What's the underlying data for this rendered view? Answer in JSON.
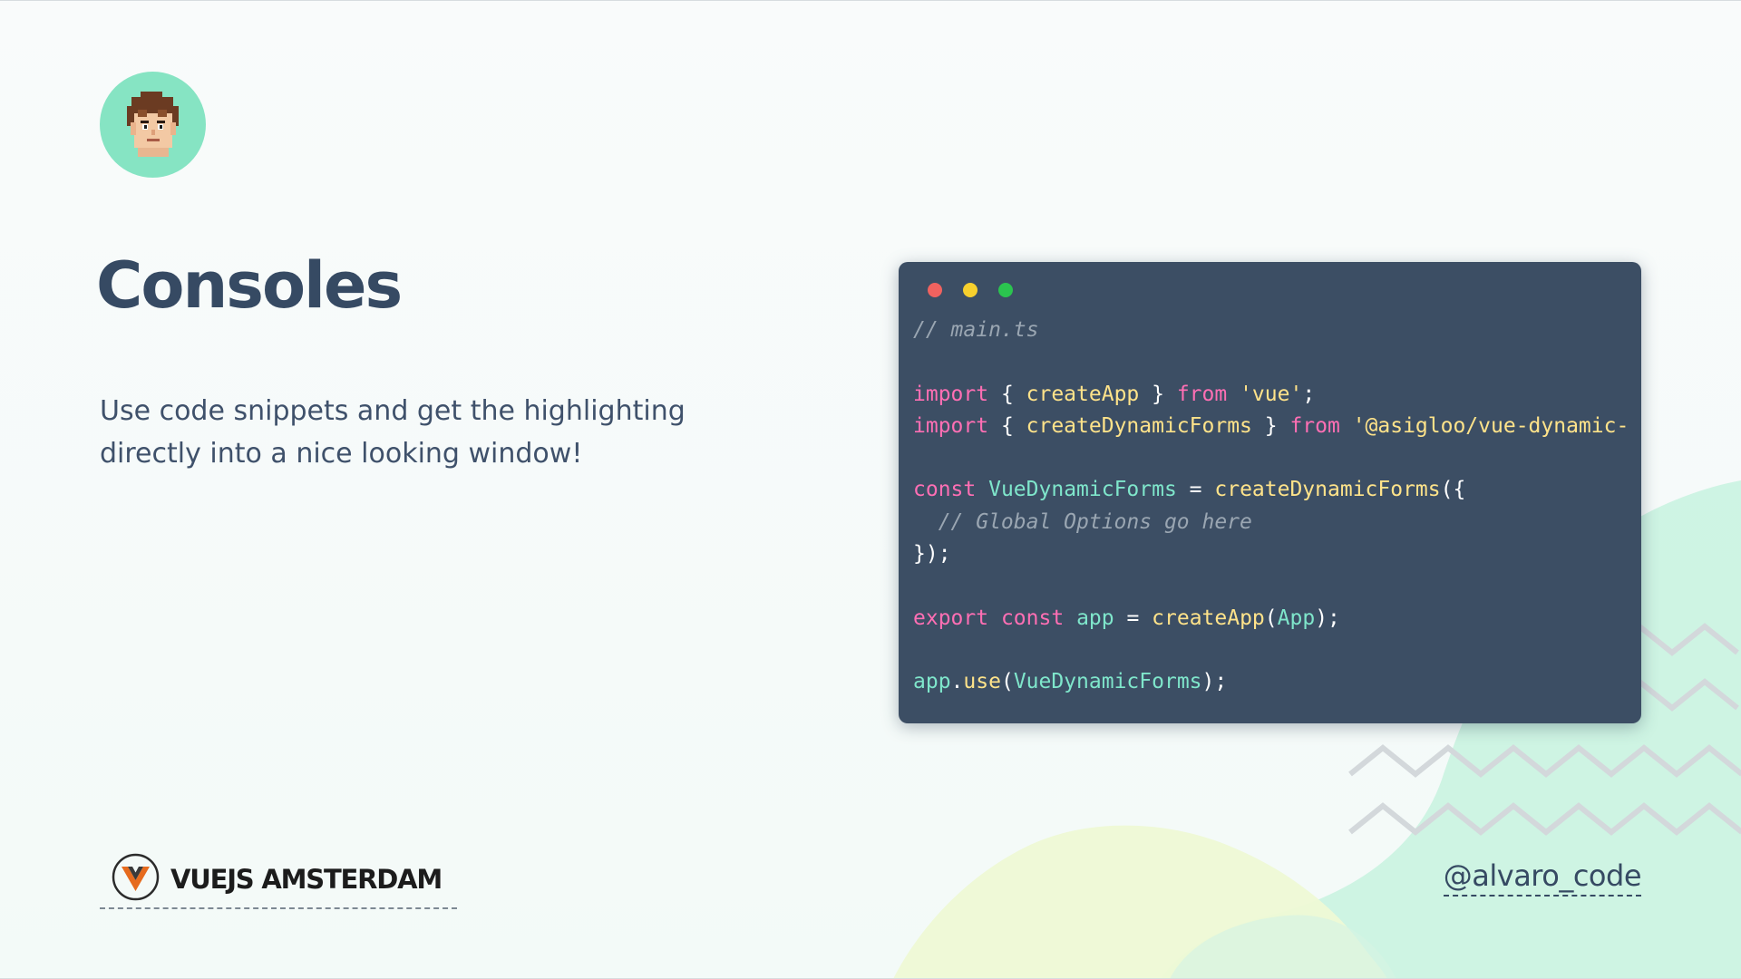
{
  "slide": {
    "title": "Consoles",
    "subtitle": "Use code snippets and get the highlighting directly into a nice looking window!",
    "footer_brand": "VUEJS AMSTERDAM",
    "handle": "@alvaro_code"
  },
  "window": {
    "dot_colors": [
      "#f0625f",
      "#f7d02d",
      "#2bc44f"
    ],
    "code_lines": [
      [
        {
          "t": "// main.ts",
          "k": "comment"
        }
      ],
      [],
      [
        {
          "t": "import",
          "k": "keyword"
        },
        {
          "t": " { ",
          "k": "punct"
        },
        {
          "t": "createApp",
          "k": "func"
        },
        {
          "t": " } ",
          "k": "punct"
        },
        {
          "t": "from",
          "k": "keyword"
        },
        {
          "t": " ",
          "k": "punct"
        },
        {
          "t": "'vue'",
          "k": "string"
        },
        {
          "t": ";",
          "k": "punct"
        }
      ],
      [
        {
          "t": "import",
          "k": "keyword"
        },
        {
          "t": " { ",
          "k": "punct"
        },
        {
          "t": "createDynamicForms",
          "k": "func"
        },
        {
          "t": " } ",
          "k": "punct"
        },
        {
          "t": "from",
          "k": "keyword"
        },
        {
          "t": " ",
          "k": "punct"
        },
        {
          "t": "'@asigloo/vue-dynamic-",
          "k": "string"
        }
      ],
      [],
      [
        {
          "t": "const",
          "k": "keyword"
        },
        {
          "t": " ",
          "k": "punct"
        },
        {
          "t": "VueDynamicForms",
          "k": "ident"
        },
        {
          "t": " = ",
          "k": "punct"
        },
        {
          "t": "createDynamicForms",
          "k": "func"
        },
        {
          "t": "({",
          "k": "punct"
        }
      ],
      [
        {
          "t": "  // Global Options go here",
          "k": "comment"
        }
      ],
      [
        {
          "t": "});",
          "k": "punct"
        }
      ],
      [],
      [
        {
          "t": "export",
          "k": "keyword"
        },
        {
          "t": " ",
          "k": "punct"
        },
        {
          "t": "const",
          "k": "keyword"
        },
        {
          "t": " ",
          "k": "punct"
        },
        {
          "t": "app",
          "k": "ident"
        },
        {
          "t": " = ",
          "k": "punct"
        },
        {
          "t": "createApp",
          "k": "func"
        },
        {
          "t": "(",
          "k": "punct"
        },
        {
          "t": "App",
          "k": "ident"
        },
        {
          "t": ");",
          "k": "punct"
        }
      ],
      [],
      [
        {
          "t": "app",
          "k": "ident"
        },
        {
          "t": ".",
          "k": "punct"
        },
        {
          "t": "use",
          "k": "func"
        },
        {
          "t": "(",
          "k": "punct"
        },
        {
          "t": "VueDynamicForms",
          "k": "ident"
        },
        {
          "t": ");",
          "k": "punct"
        }
      ]
    ]
  },
  "colors": {
    "title": "#364a63",
    "window_bg": "#3c4e64",
    "avatar_bg": "#86e4c3",
    "keyword": "#ff6fb4",
    "function": "#ffe38a",
    "identifier": "#7fe6cb",
    "comment": "#9aa6b2"
  }
}
